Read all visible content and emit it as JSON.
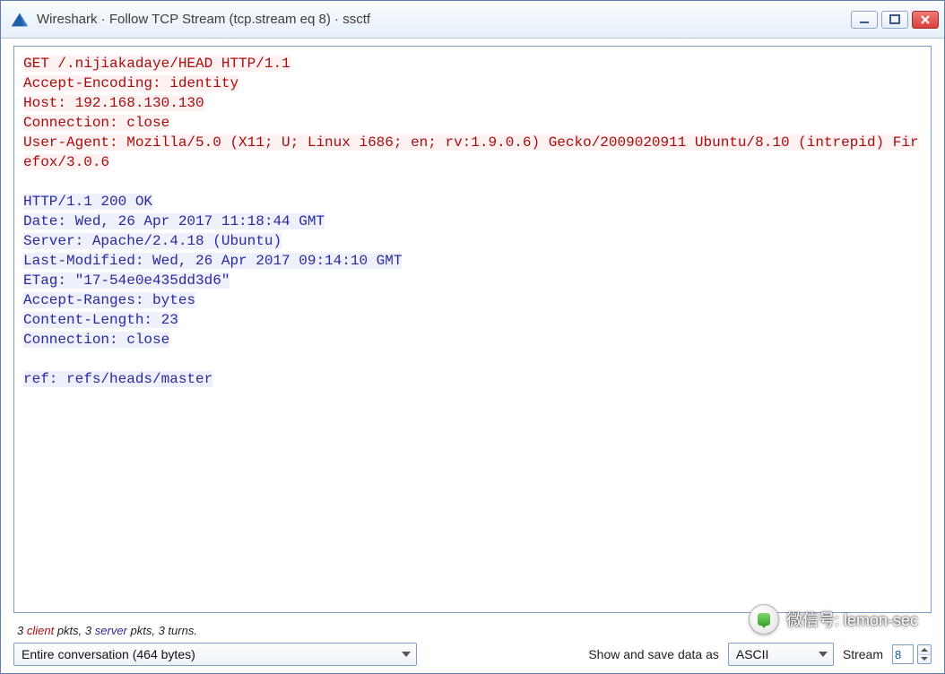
{
  "window": {
    "title": "Wireshark · Follow TCP Stream (tcp.stream eq 8) · ssctf"
  },
  "stream": {
    "request": "GET /.nijiakadaye/HEAD HTTP/1.1\nAccept-Encoding: identity\nHost: 192.168.130.130\nConnection: close\nUser-Agent: Mozilla/5.0 (X11; U; Linux i686; en; rv:1.9.0.6) Gecko/2009020911 Ubuntu/8.10 (intrepid) Firefox/3.0.6",
    "response": "HTTP/1.1 200 OK\nDate: Wed, 26 Apr 2017 11:18:44 GMT\nServer: Apache/2.4.18 (Ubuntu)\nLast-Modified: Wed, 26 Apr 2017 09:14:10 GMT\nETag: \"17-54e0e435dd3d6\"\nAccept-Ranges: bytes\nContent-Length: 23\nConnection: close\n\nref: refs/heads/master"
  },
  "stats": {
    "client_count": "3",
    "client_word": "client",
    "client_after": " pkts, ",
    "server_count": "3",
    "server_word": "server",
    "server_after": " pkts, ",
    "turns": "3 turns."
  },
  "controls": {
    "conversation_label": "Entire conversation (464 bytes)",
    "show_save_label": "Show and save data as",
    "encoding_label": "ASCII",
    "stream_label": "Stream",
    "stream_value": "8"
  },
  "watermark": {
    "text": "微信号: lemon-sec"
  }
}
